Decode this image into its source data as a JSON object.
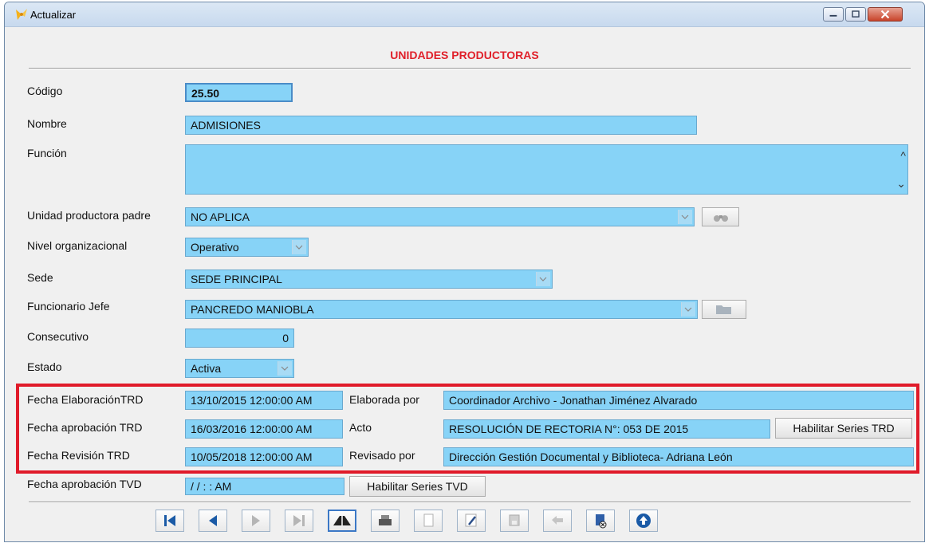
{
  "window": {
    "title": "Actualizar"
  },
  "form": {
    "heading": "UNIDADES PRODUCTORAS",
    "codigo": {
      "label": "Código",
      "value": "25.50"
    },
    "nombre": {
      "label": "Nombre",
      "value": "ADMISIONES"
    },
    "funcion": {
      "label": "Función",
      "value": ""
    },
    "unidad_padre": {
      "label": "Unidad productora padre",
      "value": "NO APLICA"
    },
    "nivel": {
      "label": "Nivel organizacional",
      "value": "Operativo"
    },
    "sede": {
      "label": "Sede",
      "value": "SEDE PRINCIPAL"
    },
    "jefe": {
      "label": "Funcionario Jefe",
      "value": "PANCREDO MANIOBLA"
    },
    "consecutivo": {
      "label": "Consecutivo",
      "value": "0"
    },
    "estado": {
      "label": "Estado",
      "value": "Activa"
    },
    "trd": {
      "elaboracion": {
        "label": "Fecha ElaboraciónTRD",
        "value": "13/10/2015 12:00:00 AM",
        "by_label": "Elaborada por",
        "by_value": "Coordinador Archivo - Jonathan Jiménez Alvarado"
      },
      "aprobacion": {
        "label": "Fecha aprobación TRD",
        "value": "16/03/2016 12:00:00 AM",
        "acto_label": "Acto",
        "acto_value": "RESOLUCIÓN DE RECTORIA N°: 053 DE 2015",
        "button": "Habilitar Series TRD"
      },
      "revision": {
        "label": "Fecha Revisión TRD",
        "value": "10/05/2018 12:00:00 AM",
        "by_label": "Revisado por",
        "by_value": "Dirección Gestión Documental y Biblioteca- Adriana León"
      }
    },
    "tvd": {
      "label": "Fecha aprobación TVD",
      "value": "/ /    : :  AM",
      "button": "Habilitar Series TVD"
    }
  },
  "toolbar": [
    "first-record",
    "previous-record",
    "next-record",
    "last-record",
    "book-search",
    "print",
    "new-record",
    "edit-record",
    "save-record",
    "undo",
    "delete-record",
    "exit"
  ],
  "colors": {
    "field": "#87d3f7",
    "heading": "#e0202a",
    "highlight_box": "#e01b2a"
  }
}
